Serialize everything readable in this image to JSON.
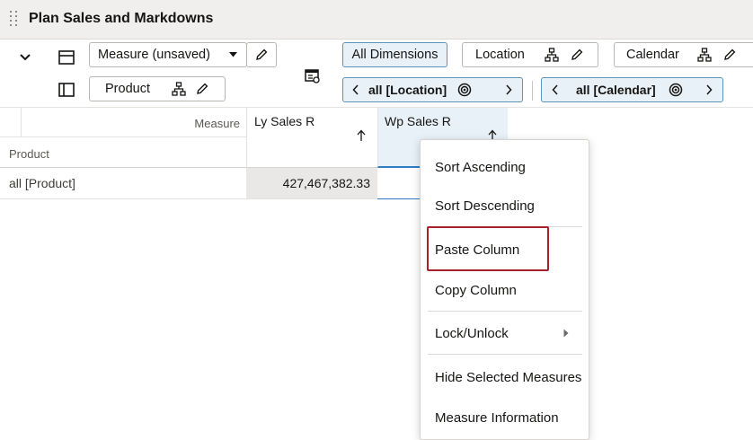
{
  "panel": {
    "title": "Plan Sales and Markdowns"
  },
  "toolbar": {
    "measure_label": "Measure (unsaved)",
    "product_label": "Product",
    "all_dimensions_label": "All Dimensions",
    "location_label": "Location",
    "calendar_label": "Calendar",
    "location_nav_value": "all [Location]",
    "calendar_nav_value": "all [Calendar]"
  },
  "grid": {
    "measure_header": "Measure",
    "product_header": "Product",
    "columns": [
      {
        "label": "Ly Sales R",
        "sort_icon": "arrow-up-icon"
      },
      {
        "label": "Wp Sales R",
        "sort_icon": "arrow-up-icon"
      }
    ],
    "rows": [
      {
        "label": "all [Product]",
        "values": [
          "427,467,382.33",
          ""
        ]
      }
    ]
  },
  "context_menu": {
    "items": [
      "Sort Ascending",
      "Sort Descending",
      "Paste Column",
      "Copy Column",
      "Lock/Unlock",
      "Hide Selected Measures",
      "Measure Information"
    ],
    "highlighted_item": "Paste Column"
  },
  "colors": {
    "highlight_border": "#a8202a",
    "selected_column": "#e8f1f8",
    "selected_accent": "#2e7cc4"
  }
}
